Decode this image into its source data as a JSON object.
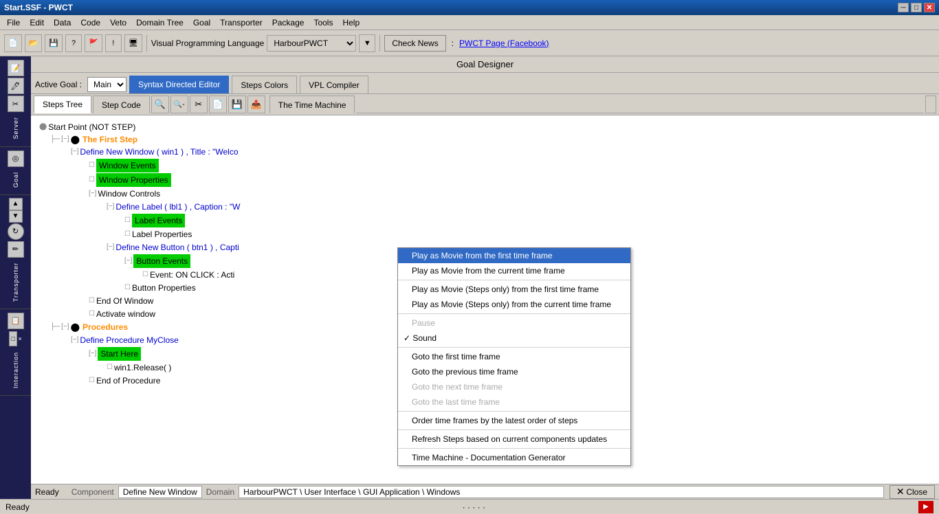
{
  "titleBar": {
    "title": "Start.SSF - PWCT",
    "minBtn": "─",
    "maxBtn": "□",
    "closeBtn": "✕"
  },
  "menuBar": {
    "items": [
      "File",
      "Edit",
      "Data",
      "Code",
      "Veto",
      "Domain Tree",
      "Goal",
      "Transporter",
      "Package",
      "Tools",
      "Help"
    ]
  },
  "toolbar": {
    "vplLabel": "Visual Programming Language",
    "harbourValue": "HarbourPWCT",
    "checkNews": "Check News",
    "pwctLink": "PWCT Page (Facebook)"
  },
  "goalDesigner": {
    "title": "Goal Designer"
  },
  "tabBar1": {
    "activeGoalLabel": "Active Goal :",
    "activeGoalValue": "Main",
    "tabs": [
      {
        "label": "Syntax Directed Editor",
        "active": true
      },
      {
        "label": "Steps Colors",
        "active": false
      },
      {
        "label": "VPL Compiler",
        "active": false
      }
    ]
  },
  "tabBar2": {
    "tabs": [
      {
        "label": "Steps Tree",
        "active": true
      },
      {
        "label": "Step Code",
        "active": false
      }
    ],
    "icons": [
      "🔍+",
      "🔍-",
      "✂",
      "📋",
      "💾",
      "📤"
    ]
  },
  "timeMachineTab": "The Time Machine",
  "timeMachineMenu": {
    "items": [
      {
        "label": "Play as Movie from the first time frame",
        "type": "selected"
      },
      {
        "label": "Play as Movie from the current time frame",
        "type": "normal"
      },
      {
        "label": "",
        "type": "separator"
      },
      {
        "label": "Play as Movie (Steps only) from the first time frame",
        "type": "normal"
      },
      {
        "label": "Play as Movie (Steps only) from the current time frame",
        "type": "normal"
      },
      {
        "label": "",
        "type": "separator"
      },
      {
        "label": "Pause",
        "type": "disabled"
      },
      {
        "label": "Sound",
        "type": "checked"
      },
      {
        "label": "",
        "type": "separator"
      },
      {
        "label": "Goto the first time frame",
        "type": "normal"
      },
      {
        "label": "Goto the previous time frame",
        "type": "normal"
      },
      {
        "label": "Goto the next time frame",
        "type": "disabled"
      },
      {
        "label": "Goto the last time frame",
        "type": "disabled"
      },
      {
        "label": "",
        "type": "separator"
      },
      {
        "label": "Order time frames by the latest order of steps",
        "type": "normal"
      },
      {
        "label": "",
        "type": "separator"
      },
      {
        "label": "Refresh Steps based on current components updates",
        "type": "normal"
      },
      {
        "label": "",
        "type": "separator"
      },
      {
        "label": "Time Machine - Documentation Generator",
        "type": "normal"
      }
    ]
  },
  "sidebar": {
    "sections": [
      "Server",
      "Goal",
      "Transporter",
      "Interaction"
    ]
  },
  "tree": {
    "nodes": [
      {
        "text": "Start Point (NOT STEP)",
        "level": 0,
        "type": "root",
        "icon": "⬤"
      },
      {
        "text": "The First Step",
        "level": 1,
        "type": "orange",
        "icon": "⬤"
      },
      {
        "text": "Define New Window  ( win1 ) , Title : \"Welco",
        "level": 2,
        "type": "blue"
      },
      {
        "text": "Window Events",
        "level": 3,
        "type": "green"
      },
      {
        "text": "Window Properties",
        "level": 3,
        "type": "green"
      },
      {
        "text": "Window Controls",
        "level": 3,
        "type": "normal"
      },
      {
        "text": "Define Label ( lbl1 ) , Caption : \"W",
        "level": 4,
        "type": "blue"
      },
      {
        "text": "Label Events",
        "level": 5,
        "type": "green"
      },
      {
        "text": "Label Properties",
        "level": 5,
        "type": "normal"
      },
      {
        "text": "Define New Button ( btn1 ) , Capti",
        "level": 4,
        "type": "blue"
      },
      {
        "text": "Button Events",
        "level": 5,
        "type": "green"
      },
      {
        "text": "Event: ON CLICK : Acti",
        "level": 6,
        "type": "normal"
      },
      {
        "text": "Button Properties",
        "level": 5,
        "type": "normal"
      },
      {
        "text": "End Of Window",
        "level": 3,
        "type": "normal"
      },
      {
        "text": "Activate window",
        "level": 3,
        "type": "normal"
      },
      {
        "text": "Procedures",
        "level": 1,
        "type": "orange",
        "icon": "⬤"
      },
      {
        "text": "Define Procedure MyClose",
        "level": 2,
        "type": "blue"
      },
      {
        "text": "Start Here",
        "level": 3,
        "type": "green"
      },
      {
        "text": "win1.Release( )",
        "level": 4,
        "type": "normal"
      },
      {
        "text": "End of Procedure",
        "level": 3,
        "type": "normal"
      }
    ]
  },
  "statusBar": {
    "readyLabel": "Ready",
    "componentLabel": "Component",
    "componentValue": "Define New Window",
    "domainLabel": "Domain",
    "domainValue": "HarbourPWCT \\ User Interface \\ GUI Application \\ Windows",
    "closeBtn": "Close"
  }
}
